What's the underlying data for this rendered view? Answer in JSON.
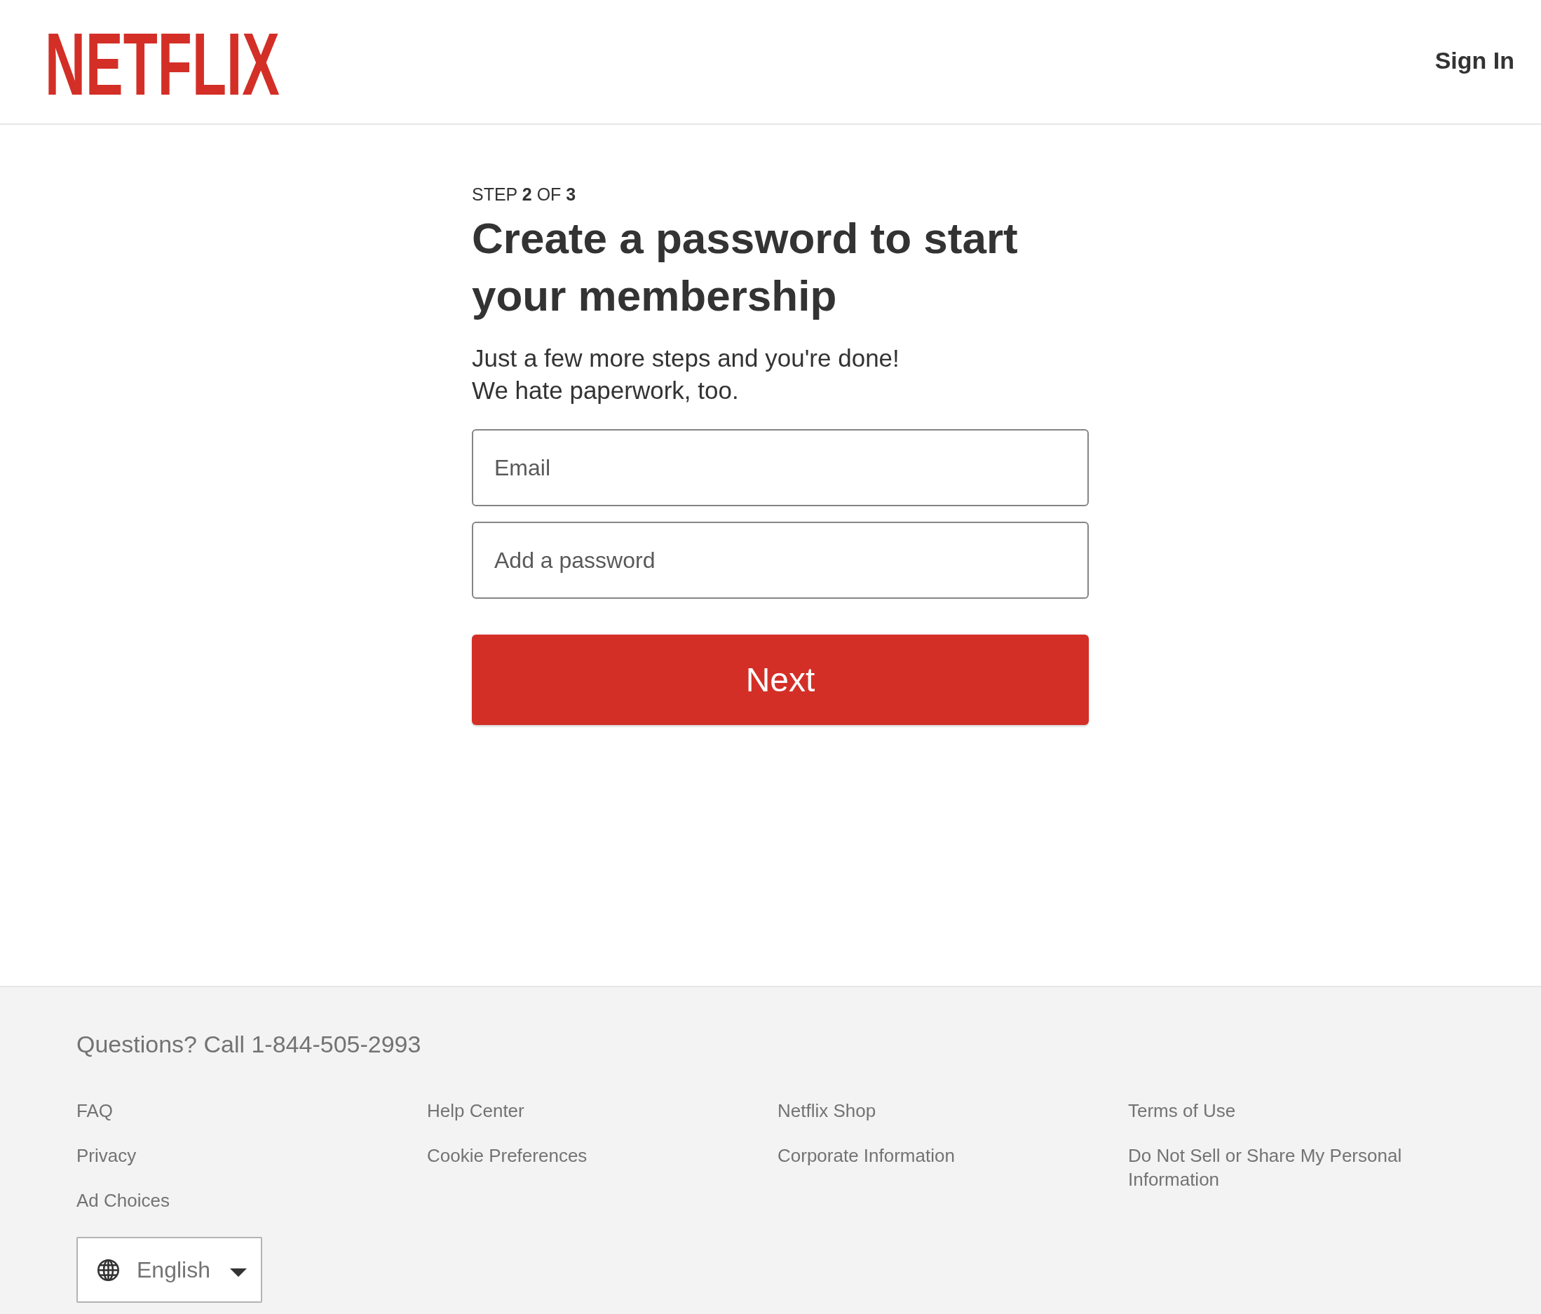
{
  "header": {
    "logo": "NETFLIX",
    "sign_in": "Sign In"
  },
  "form": {
    "step": "STEP **2** OF **3**",
    "title": "Create a password to start your membership",
    "subtitle_lines": [
      "Just a few more steps and you're done!",
      "We hate paperwork, too."
    ],
    "fields": [
      {
        "placeholder": "Email"
      },
      {
        "placeholder": "Add a password"
      }
    ],
    "submit": "Next"
  },
  "footer": {
    "questions": "Questions? Call 1-844-505-2993",
    "link_columns": [
      {
        "links": [
          "FAQ",
          "Privacy",
          "Ad Choices"
        ]
      },
      {
        "links": [
          "Help Center",
          "Cookie Preferences"
        ]
      },
      {
        "links": [
          "Netflix Shop",
          "Corporate Information"
        ]
      },
      {
        "links": [
          "Terms of Use",
          "Do Not Sell or Share My Personal Information"
        ]
      }
    ],
    "language": {
      "label": "English"
    }
  }
}
